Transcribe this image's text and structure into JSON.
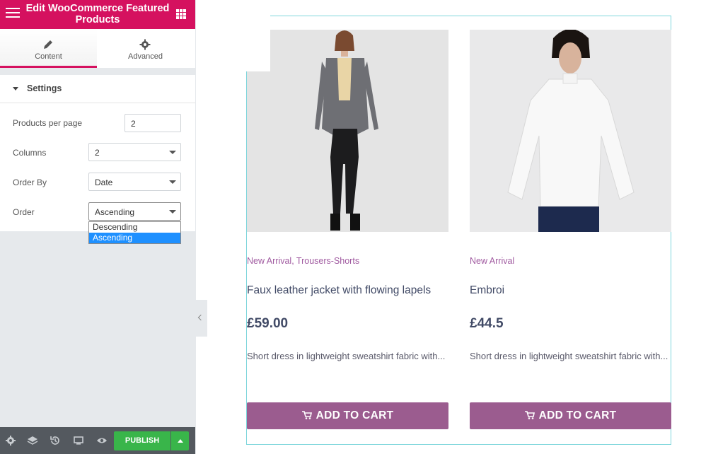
{
  "topbar": {
    "title": "Edit WooCommerce Featured Products"
  },
  "tabs": [
    {
      "label": "Content",
      "icon": "pencil-icon"
    },
    {
      "label": "Advanced",
      "icon": "gear-icon"
    }
  ],
  "section": {
    "title": "Settings"
  },
  "fields": {
    "products_per_page": {
      "label": "Products per page",
      "value": "2"
    },
    "columns": {
      "label": "Columns",
      "value": "2"
    },
    "order_by": {
      "label": "Order By",
      "value": "Date"
    },
    "order": {
      "label": "Order",
      "value": "Ascending",
      "options": [
        "Descending",
        "Ascending"
      ]
    }
  },
  "bottombar": {
    "publish_label": "PUBLISH"
  },
  "products": [
    {
      "category": "New Arrival, Trousers-Shorts",
      "name": "Faux leather jacket with flowing lapels",
      "price": "£59.00",
      "description": "Short dress in lightweight sweatshirt fabric with...",
      "button": "ADD TO CART"
    },
    {
      "category": "New Arrival",
      "name": "Embroi",
      "price": "£44.5",
      "description": "Short dress in lightweight sweatshirt fabric with...",
      "button": "ADD TO CART"
    }
  ],
  "colors": {
    "accent": "#d5115f",
    "publish": "#39b54a",
    "cart_button": "#9b5c8f",
    "category": "#a05aa0"
  }
}
